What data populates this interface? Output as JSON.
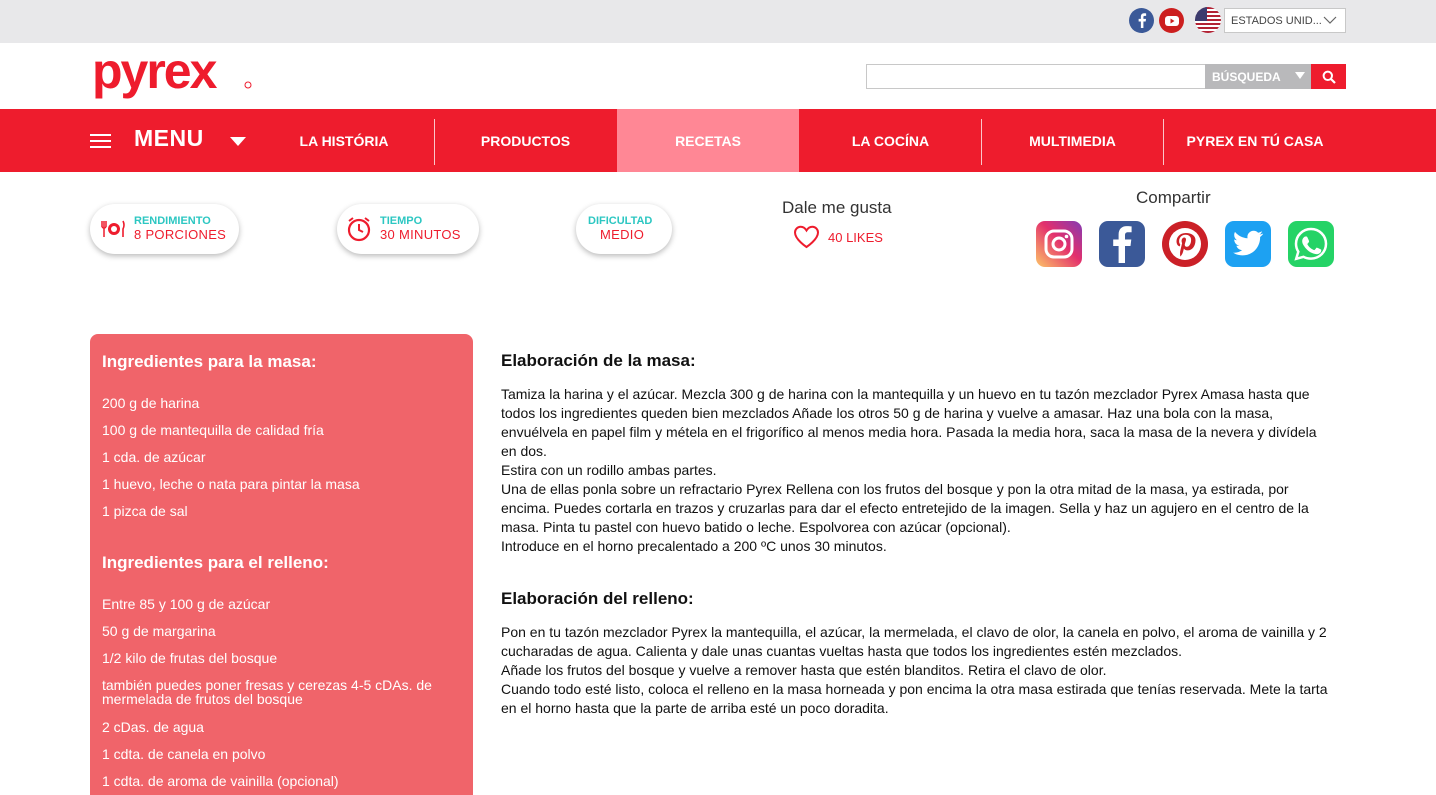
{
  "topbar": {
    "country_label": "ESTADOS UNID...",
    "social": [
      {
        "name": "facebook-icon"
      },
      {
        "name": "youtube-icon"
      }
    ]
  },
  "header": {
    "logo_text": "pyrex",
    "search": {
      "placeholder": "",
      "select_label": "BÚSQUEDA"
    }
  },
  "nav": {
    "menu_label": "MENU",
    "items": [
      {
        "label": "LA HISTÓRIA"
      },
      {
        "label": "PRODUCTOS"
      },
      {
        "label": "RECETAS"
      },
      {
        "label": "LA COCÍNA"
      },
      {
        "label": "MULTIMEDIA"
      },
      {
        "label": "PYREX EN TÚ CASA"
      }
    ],
    "active_index": 2
  },
  "recipe_meta": {
    "yield": {
      "label": "RENDIMIENTO",
      "value": "8 PORCIONES"
    },
    "time": {
      "label": "TIEMPO",
      "value": "30 MINUTOS"
    },
    "difficulty": {
      "label": "DIFICULTAD",
      "value": "MEDIO"
    }
  },
  "likes": {
    "title": "Dale me gusta",
    "count": "40 LIKES"
  },
  "share": {
    "title": "Compartir",
    "networks": [
      "instagram-icon",
      "facebook-icon",
      "pinterest-icon",
      "twitter-icon",
      "whatsapp-icon"
    ]
  },
  "ingredients": {
    "dough_title": "Ingredientes para la masa:",
    "dough_items": [
      "200 g de harina",
      "100 g de mantequilla de calidad fría",
      "1 cda. de azúcar",
      "1 huevo, leche o nata para pintar la masa",
      "1 pizca de sal"
    ],
    "filling_title": "Ingredientes para el relleno:",
    "filling_items": [
      "Entre 85 y 100 g de azúcar",
      "50 g de margarina",
      "1/2 kilo de frutas del bosque",
      "también puedes poner fresas y cerezas 4-5 cDAs. de mermelada de frutos del bosque",
      "2 cDas. de agua",
      "1 cdta. de canela en polvo",
      "1 cdta. de aroma de vainilla (opcional)"
    ]
  },
  "elaboration": {
    "dough_title": "Elaboración de la masa:",
    "dough_text": [
      "Tamiza la harina y el azúcar. Mezcla 300 g de harina con la mantequilla y un huevo en tu tazón mezclador Pyrex Amasa hasta que todos los ingredientes queden bien mezclados Añade los otros 50 g de harina y vuelve a amasar. Haz una bola con la masa, envuélvela en papel film y métela en el frigorífico al menos media hora. Pasada la media hora, saca la masa de la nevera y divídela en dos.",
      "Estira con un rodillo ambas partes.",
      "Una de ellas ponla sobre un refractario Pyrex Rellena con los frutos del bosque y pon la otra mitad de la masa, ya estirada, por encima. Puedes cortarla en trazos y cruzarlas para dar el efecto entretejido de la imagen. Sella y haz un agujero en el centro de la masa. Pinta tu pastel con huevo batido o leche. Espolvorea con azúcar (opcional).",
      "Introduce en el horno precalentado a 200 ºC unos 30 minutos."
    ],
    "filling_title": "Elaboración del relleno:",
    "filling_text": [
      "Pon en tu tazón mezclador Pyrex la mantequilla, el azúcar, la mermelada, el clavo de olor, la canela en polvo, el aroma de vainilla y 2 cucharadas de agua. Calienta y dale unas cuantas vueltas hasta que todos los ingredientes estén mezclados.",
      "Añade los frutos del bosque y vuelve a remover hasta que estén blanditos. Retira el clavo de olor.",
      "Cuando todo esté listo, coloca el relleno en la masa horneada y pon encima la otra masa estirada que tenías reservada. Mete la tarta en el horno hasta que la parte de arriba esté un poco doradita."
    ]
  },
  "colors": {
    "brand_red": "#ee1c2d",
    "active_tab": "#ff8795",
    "ingredients_bg": "#f0646a",
    "accent_teal": "#2cc7c2"
  }
}
